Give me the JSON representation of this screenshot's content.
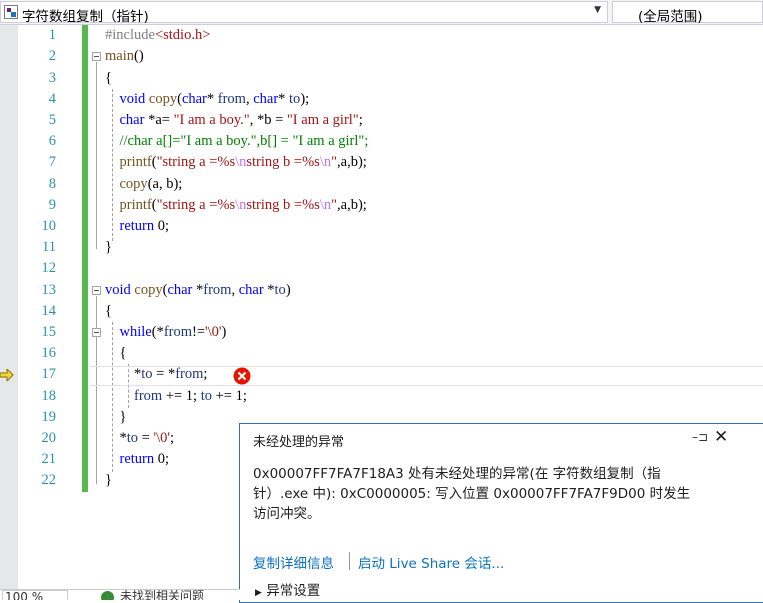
{
  "topbar": {
    "project": "字符数组复制（指针)",
    "scope": "(全局范围)",
    "project_icon": "cpp-project-icon",
    "dropdown_icon": "chevron-down-icon"
  },
  "editor": {
    "line_numbers": [
      "1",
      "2",
      "3",
      "4",
      "5",
      "6",
      "7",
      "8",
      "9",
      "10",
      "11",
      "12",
      "13",
      "14",
      "15",
      "16",
      "17",
      "18",
      "19",
      "20",
      "21",
      "22"
    ],
    "current_line": "17",
    "error_icon": "error-circle-icon"
  },
  "exception": {
    "title": "未经处理的异常",
    "message_line1": "0x00007FF7FA7F18A3 处有未经处理的异常(在 字符数组复制（指",
    "message_line2": "针）.exe 中): 0xC0000005: 写入位置 0x00007FF7FA7F9D00 时发生",
    "message_line3": "访问冲突。",
    "copy_details": "复制详细信息",
    "live_share": "启动 Live Share 会话...",
    "exception_settings": "异常设置",
    "pin_icon": "pin-icon",
    "close_icon": "close-icon"
  },
  "status": {
    "zoom": "100 %",
    "issues": "未找到相关问题"
  },
  "colors": {
    "keyword": "#0000ff",
    "string": "#a31515",
    "comment": "#008000",
    "line_number": "#2b91af",
    "change_bar": "#57b84c",
    "link": "#0e70c0"
  }
}
